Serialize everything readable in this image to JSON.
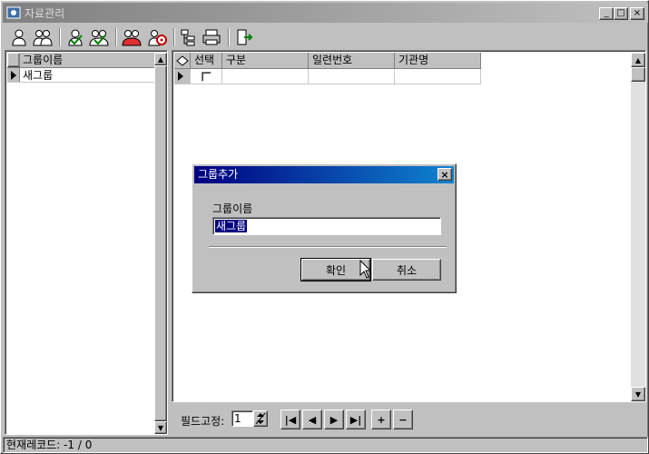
{
  "window": {
    "title": "자료관리",
    "buttons": {
      "minimize": "_",
      "maximize": "□",
      "close": "×"
    }
  },
  "toolbar": {
    "icons": [
      "person-icon",
      "people-icon",
      "person-check-icon",
      "people-check-icon",
      "people-red-icon",
      "person-target-icon",
      "tree-icon",
      "print-icon",
      "exit-icon"
    ]
  },
  "left_grid": {
    "columns": [
      "그룹이름"
    ],
    "rows": [
      {
        "name": "새그룹"
      }
    ]
  },
  "main_grid": {
    "columns": [
      "선택",
      "구분",
      "일련번호",
      "기관명"
    ],
    "rows": [
      {
        "selected": false,
        "type": "",
        "serial": "",
        "org": ""
      }
    ]
  },
  "navbar": {
    "fix_label": "필드고정:",
    "fix_value": "1",
    "buttons": {
      "first": "|◀",
      "prev": "◀",
      "next": "▶",
      "last": "▶|",
      "add": "+",
      "remove": "−"
    }
  },
  "status": {
    "text": "현재레코드: -1 / 0"
  },
  "dialog": {
    "title": "그룹추가",
    "label": "그룹이름",
    "input_value": "새그룹",
    "ok_label": "확인",
    "cancel_label": "취소",
    "close_glyph": "×"
  },
  "colors": {
    "dialog_title_start": "#000080",
    "dialog_title_end": "#1084d0",
    "face": "#c0c0c0"
  }
}
